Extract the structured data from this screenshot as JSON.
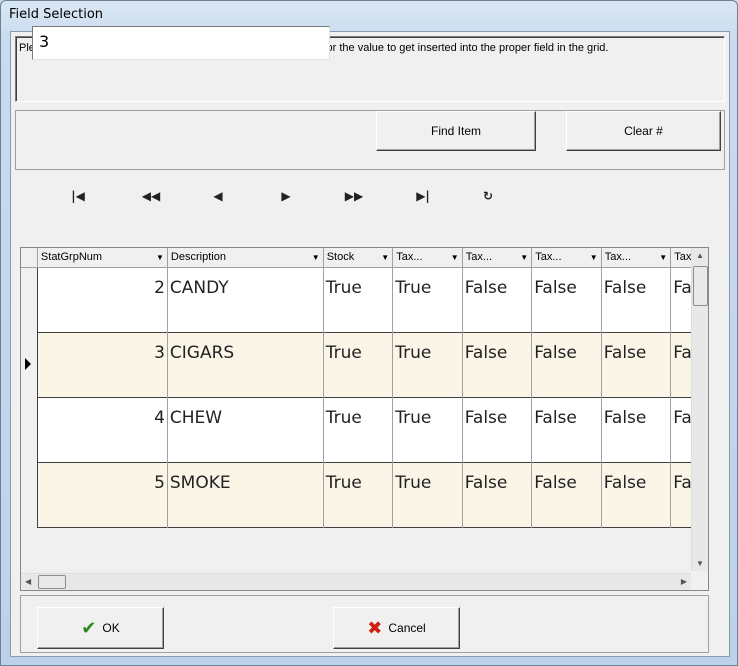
{
  "window": {
    "title": "Field Selection"
  },
  "instructions": "Please make your selection from the table below and click OK for the value to get inserted into the proper field in the grid.",
  "search": {
    "value": "3",
    "find_label": "Find Item",
    "clear_label": "Clear #"
  },
  "navigator": {
    "first": "⏮",
    "prior_page": "⏪",
    "prior": "◀",
    "next": "▶",
    "next_page": "⏩",
    "last": "⏭",
    "refresh": "↻"
  },
  "grid": {
    "columns": [
      "StatGrpNum",
      "Description",
      "Stock",
      "Tax...",
      "Tax...",
      "Tax...",
      "Tax...",
      "Tax"
    ],
    "rows": [
      [
        "2",
        "CANDY",
        "True",
        "True",
        "False",
        "False",
        "False",
        "Fa"
      ],
      [
        "3",
        "CIGARS",
        "True",
        "True",
        "False",
        "False",
        "False",
        "Fa"
      ],
      [
        "4",
        "CHEW",
        "True",
        "True",
        "False",
        "False",
        "False",
        "Fa"
      ],
      [
        "5",
        "SMOKE",
        "True",
        "True",
        "False",
        "False",
        "False",
        "Fa"
      ]
    ],
    "selected_row": 1
  },
  "buttons": {
    "ok": "OK",
    "cancel": "Cancel"
  },
  "icons": {
    "ok": "check-icon",
    "cancel": "x-icon"
  },
  "colors": {
    "row_alt": "#fbf5e8",
    "ok_check": "#2a8a1a",
    "cancel_x": "#d02010"
  }
}
